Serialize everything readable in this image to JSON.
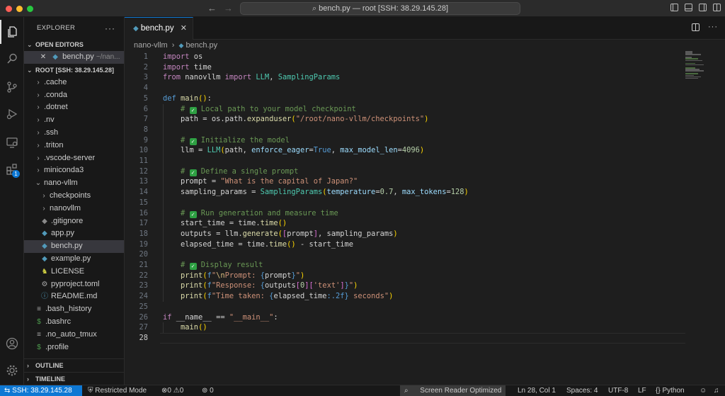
{
  "colors": {
    "accent": "#0e78d4",
    "close": "#ff5f57",
    "minimize": "#febc2e",
    "maximize": "#28c840"
  },
  "titlebar": {
    "command_center": "bench.py — root [SSH: 38.29.145.28]"
  },
  "sidebar": {
    "title": "EXPLORER",
    "open_editors_label": "OPEN EDITORS",
    "open_editor": {
      "name": "bench.py",
      "path": "~/nan..."
    },
    "root_label": "ROOT [SSH: 38.29.145.28]",
    "tree": [
      {
        "name": ".cache",
        "type": "folder",
        "depth": 1
      },
      {
        "name": ".conda",
        "type": "folder",
        "depth": 1
      },
      {
        "name": ".dotnet",
        "type": "folder",
        "depth": 1
      },
      {
        "name": ".nv",
        "type": "folder",
        "depth": 1
      },
      {
        "name": ".ssh",
        "type": "folder",
        "depth": 1
      },
      {
        "name": ".triton",
        "type": "folder",
        "depth": 1
      },
      {
        "name": ".vscode-server",
        "type": "folder",
        "depth": 1
      },
      {
        "name": "miniconda3",
        "type": "folder",
        "depth": 1
      },
      {
        "name": "nano-vllm",
        "type": "folder-open",
        "depth": 1
      },
      {
        "name": "checkpoints",
        "type": "folder",
        "depth": 2
      },
      {
        "name": "nanovllm",
        "type": "folder",
        "depth": 2
      },
      {
        "name": ".gitignore",
        "type": "git",
        "depth": 2
      },
      {
        "name": "app.py",
        "type": "py",
        "depth": 2
      },
      {
        "name": "bench.py",
        "type": "py",
        "depth": 2,
        "selected": true
      },
      {
        "name": "example.py",
        "type": "py",
        "depth": 2
      },
      {
        "name": "LICENSE",
        "type": "license",
        "depth": 2
      },
      {
        "name": "pyproject.toml",
        "type": "gear",
        "depth": 2
      },
      {
        "name": "README.md",
        "type": "info",
        "depth": 2
      },
      {
        "name": ".bash_history",
        "type": "text",
        "depth": 1
      },
      {
        "name": ".bashrc",
        "type": "shell",
        "depth": 1
      },
      {
        "name": ".no_auto_tmux",
        "type": "text",
        "depth": 1
      },
      {
        "name": ".profile",
        "type": "shell",
        "depth": 1
      }
    ],
    "outline_label": "OUTLINE",
    "timeline_label": "TIMELINE"
  },
  "activity": {
    "extensions_badge": "1"
  },
  "editor": {
    "tab_label": "bench.py",
    "breadcrumb": {
      "folder": "nano-vllm",
      "file": "bench.py"
    },
    "current_line": 28,
    "lines": [
      [
        [
          "kw",
          "import"
        ],
        [
          "t",
          " os"
        ]
      ],
      [
        [
          "kw",
          "import"
        ],
        [
          "t",
          " time"
        ]
      ],
      [
        [
          "kw",
          "from"
        ],
        [
          "t",
          " nanovllm "
        ],
        [
          "kw",
          "import"
        ],
        [
          "t",
          " "
        ],
        [
          "cls",
          "LLM"
        ],
        [
          "t",
          ", "
        ],
        [
          "cls",
          "SamplingParams"
        ]
      ],
      [],
      [
        [
          "kd",
          "def"
        ],
        [
          "t",
          " "
        ],
        [
          "fn",
          "main"
        ],
        [
          "br1",
          "()"
        ],
        [
          "t",
          ":"
        ]
      ],
      [
        [
          "t",
          "    "
        ],
        [
          "cmt",
          "# "
        ],
        [
          "chk",
          "✓"
        ],
        [
          "cmt",
          " Local path to your model checkpoint"
        ]
      ],
      [
        [
          "t",
          "    path = os.path."
        ],
        [
          "fn",
          "expanduser"
        ],
        [
          "br1",
          "("
        ],
        [
          "str",
          "\"/root/nano-vllm/checkpoints\""
        ],
        [
          "br1",
          ")"
        ]
      ],
      [],
      [
        [
          "t",
          "    "
        ],
        [
          "cmt",
          "# "
        ],
        [
          "chk",
          "✓"
        ],
        [
          "cmt",
          " Initialize the model"
        ]
      ],
      [
        [
          "t",
          "    llm = "
        ],
        [
          "cls",
          "LLM"
        ],
        [
          "br1",
          "("
        ],
        [
          "t",
          "path, "
        ],
        [
          "par",
          "enforce_eager"
        ],
        [
          "t",
          "="
        ],
        [
          "kd",
          "True"
        ],
        [
          "t",
          ", "
        ],
        [
          "par",
          "max_model_len"
        ],
        [
          "t",
          "="
        ],
        [
          "num",
          "4096"
        ],
        [
          "br1",
          ")"
        ]
      ],
      [],
      [
        [
          "t",
          "    "
        ],
        [
          "cmt",
          "# "
        ],
        [
          "chk",
          "✓"
        ],
        [
          "cmt",
          " Define a single prompt"
        ]
      ],
      [
        [
          "t",
          "    prompt = "
        ],
        [
          "str",
          "\"What is the capital of Japan?\""
        ]
      ],
      [
        [
          "t",
          "    sampling_params = "
        ],
        [
          "cls",
          "SamplingParams"
        ],
        [
          "br1",
          "("
        ],
        [
          "par",
          "temperature"
        ],
        [
          "t",
          "="
        ],
        [
          "num",
          "0.7"
        ],
        [
          "t",
          ", "
        ],
        [
          "par",
          "max_tokens"
        ],
        [
          "t",
          "="
        ],
        [
          "num",
          "128"
        ],
        [
          "br1",
          ")"
        ]
      ],
      [],
      [
        [
          "t",
          "    "
        ],
        [
          "cmt",
          "# "
        ],
        [
          "chk",
          "✓"
        ],
        [
          "cmt",
          " Run generation and measure time"
        ]
      ],
      [
        [
          "t",
          "    start_time = time."
        ],
        [
          "fn",
          "time"
        ],
        [
          "br1",
          "()"
        ]
      ],
      [
        [
          "t",
          "    outputs = llm."
        ],
        [
          "fn",
          "generate"
        ],
        [
          "br1",
          "("
        ],
        [
          "br2",
          "["
        ],
        [
          "t",
          "prompt"
        ],
        [
          "br2",
          "]"
        ],
        [
          "t",
          ", sampling_params"
        ],
        [
          "br1",
          ")"
        ]
      ],
      [
        [
          "t",
          "    elapsed_time = time."
        ],
        [
          "fn",
          "time"
        ],
        [
          "br1",
          "()"
        ],
        [
          "t",
          " - start_time"
        ]
      ],
      [],
      [
        [
          "t",
          "    "
        ],
        [
          "cmt",
          "# "
        ],
        [
          "chk",
          "✓"
        ],
        [
          "cmt",
          " Display result"
        ]
      ],
      [
        [
          "t",
          "    "
        ],
        [
          "fn",
          "print"
        ],
        [
          "br1",
          "("
        ],
        [
          "kd",
          "f"
        ],
        [
          "str",
          "\""
        ],
        [
          "esc",
          "\\n"
        ],
        [
          "str",
          "Prompt: "
        ],
        [
          "kd",
          "{"
        ],
        [
          "t",
          "prompt"
        ],
        [
          "kd",
          "}"
        ],
        [
          "str",
          "\""
        ],
        [
          "br1",
          ")"
        ]
      ],
      [
        [
          "t",
          "    "
        ],
        [
          "fn",
          "print"
        ],
        [
          "br1",
          "("
        ],
        [
          "kd",
          "f"
        ],
        [
          "str",
          "\"Response: "
        ],
        [
          "kd",
          "{"
        ],
        [
          "t",
          "outputs"
        ],
        [
          "br2",
          "["
        ],
        [
          "num",
          "0"
        ],
        [
          "br2",
          "]"
        ],
        [
          "br2",
          "["
        ],
        [
          "str",
          "'text'"
        ],
        [
          "br2",
          "]"
        ],
        [
          "kd",
          "}"
        ],
        [
          "str",
          "\""
        ],
        [
          "br1",
          ")"
        ]
      ],
      [
        [
          "t",
          "    "
        ],
        [
          "fn",
          "print"
        ],
        [
          "br1",
          "("
        ],
        [
          "kd",
          "f"
        ],
        [
          "str",
          "\"Time taken: "
        ],
        [
          "kd",
          "{"
        ],
        [
          "t",
          "elapsed_time"
        ],
        [
          "kd",
          ":.2f"
        ],
        [
          "kd",
          "}"
        ],
        [
          "str",
          " seconds\""
        ],
        [
          "br1",
          ")"
        ]
      ],
      [],
      [
        [
          "kw",
          "if"
        ],
        [
          "t",
          " __name__ == "
        ],
        [
          "str",
          "\"__main__\""
        ],
        [
          "t",
          ":"
        ]
      ],
      [
        [
          "t",
          "    "
        ],
        [
          "fn",
          "main"
        ],
        [
          "br1",
          "()"
        ]
      ],
      []
    ]
  },
  "statusbar": {
    "remote": "SSH: 38.29.145.28",
    "restricted": "Restricted Mode",
    "errors": "0",
    "warnings": "0",
    "ports": "0",
    "screen_reader": "Screen Reader Optimized",
    "position": "Ln 28, Col 1",
    "spaces": "Spaces: 4",
    "encoding": "UTF-8",
    "eol": "LF",
    "language": "Python"
  }
}
